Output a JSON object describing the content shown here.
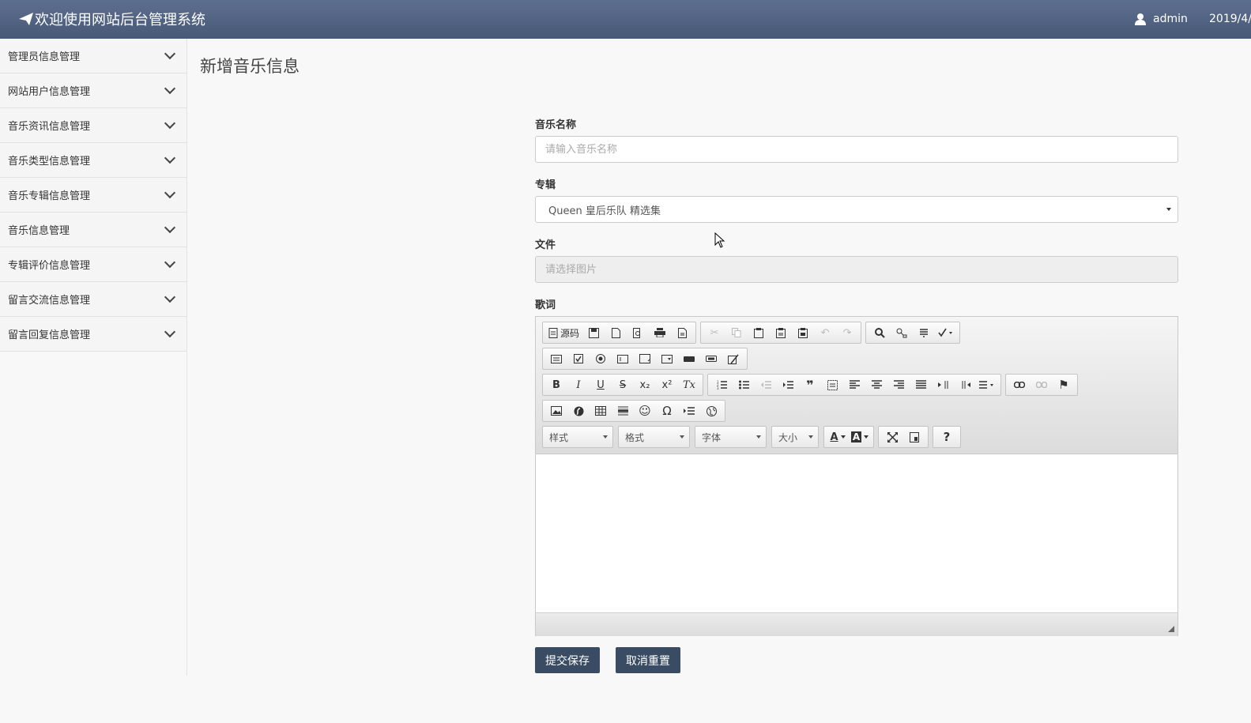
{
  "header": {
    "title": "欢迎使用网站后台管理系统",
    "user": "admin",
    "date": "2019/4/"
  },
  "sidebar": {
    "items": [
      {
        "label": "管理员信息管理"
      },
      {
        "label": "网站用户信息管理"
      },
      {
        "label": "音乐资讯信息管理"
      },
      {
        "label": "音乐类型信息管理"
      },
      {
        "label": "音乐专辑信息管理"
      },
      {
        "label": "音乐信息管理"
      },
      {
        "label": "专辑评价信息管理"
      },
      {
        "label": "留言交流信息管理"
      },
      {
        "label": "留言回复信息管理"
      }
    ]
  },
  "main": {
    "page_title": "新增音乐信息",
    "form": {
      "name_label": "音乐名称",
      "name_placeholder": "请输入音乐名称",
      "album_label": "专辑",
      "album_value": "Queen 皇后乐队 精选集",
      "file_label": "文件",
      "file_placeholder": "请选择图片",
      "lyrics_label": "歌词"
    },
    "editor": {
      "source_label": "源码",
      "style_drop": "样式",
      "format_drop": "格式",
      "font_drop": "字体",
      "size_drop": "大小",
      "font_color": "A",
      "bg_color": "A",
      "help": "?",
      "icons": {
        "bold": "B",
        "italic": "I",
        "underline": "U",
        "strike": "S",
        "subscript": "x₂",
        "superscript": "x²",
        "remove_format": "Tx",
        "blockquote": "❞",
        "special_char": "Ω",
        "smiley": "☺",
        "flag": "⚑",
        "find": "🔍",
        "undo": "↶",
        "redo": "↷",
        "cut": "✂"
      }
    },
    "buttons": {
      "submit": "提交保存",
      "reset": "取消重置"
    }
  }
}
